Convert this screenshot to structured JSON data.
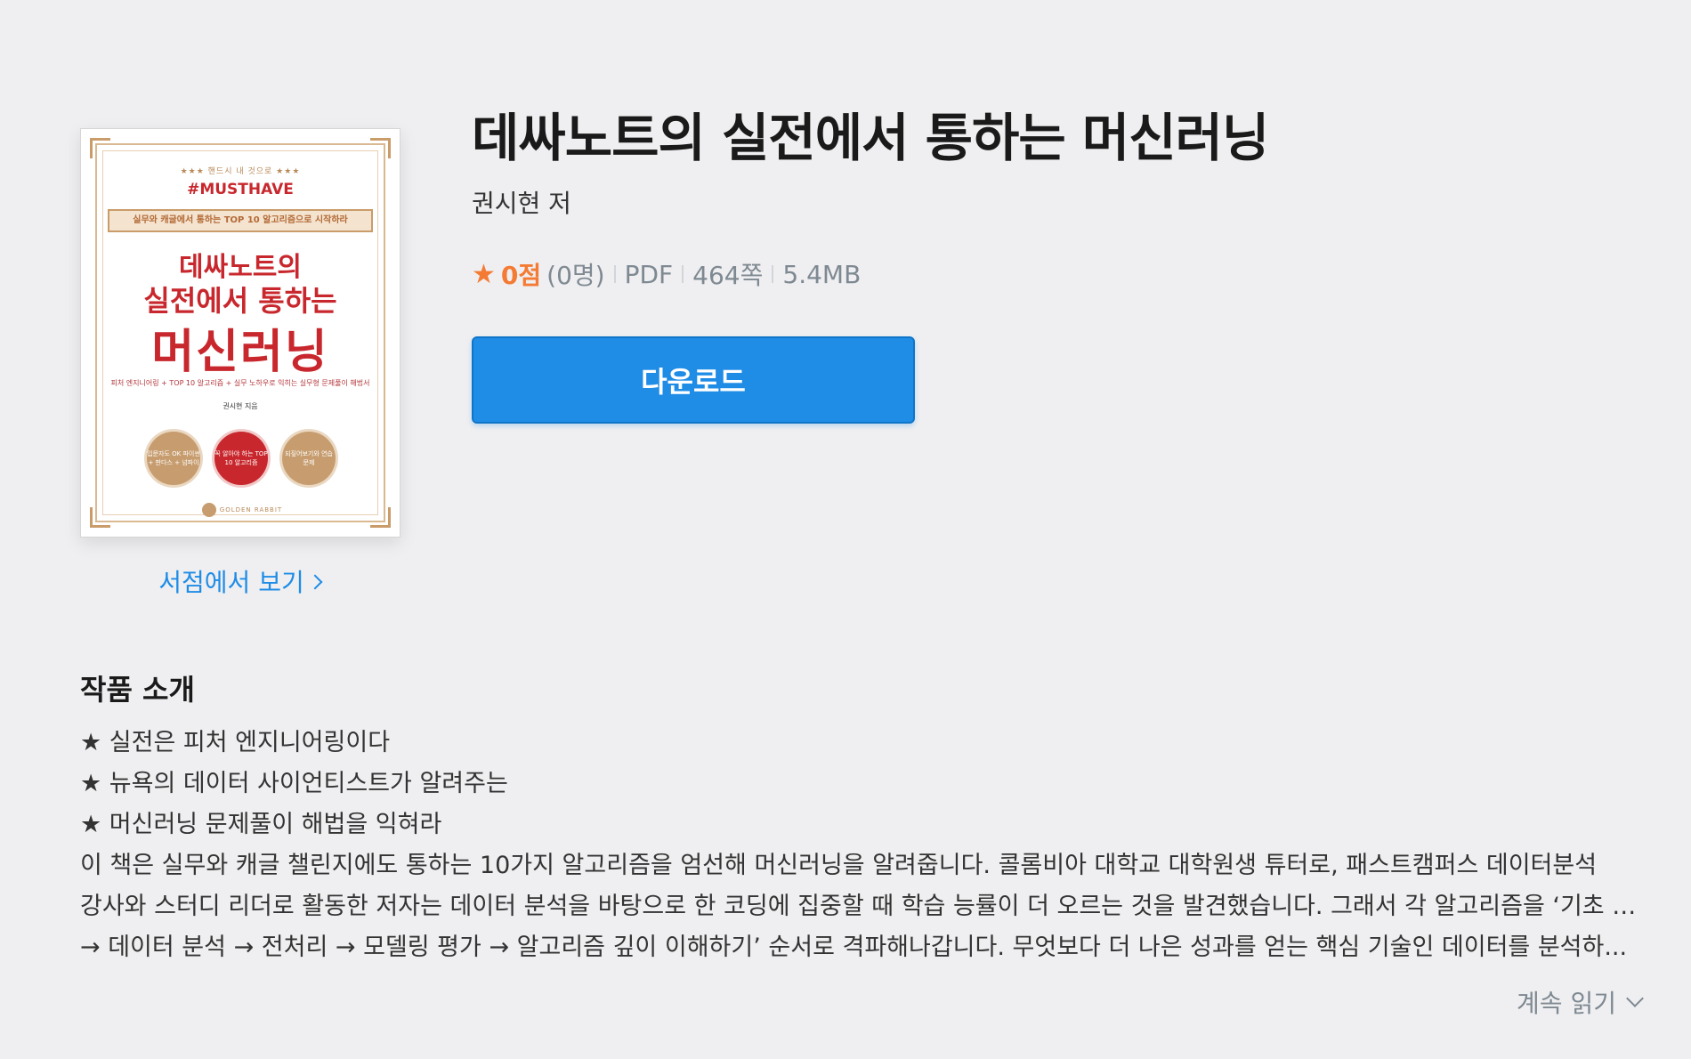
{
  "book": {
    "title": "데싸노트의 실전에서 통하는 머신러닝",
    "author": "권시현 저",
    "rating_icon": "star-icon",
    "rating": "0점",
    "rating_count": "(0명)",
    "format": "PDF",
    "pages": "464쪽",
    "file_size": "5.4MB",
    "download_label": "다운로드",
    "store_link_label": "서점에서 보기"
  },
  "cover": {
    "kicker": "★★★ 핸드시 내 것으로 ★★★",
    "tag": "#MUSTHAVE",
    "ribbon": "실무와 캐글에서 통하는 TOP 10 알고리즘으로 시작하라",
    "title_line1": "데싸노트의",
    "title_line2": "실전에서 통하는",
    "title_line3": "머신러닝",
    "subtitle": "피처 엔지니어링 + TOP 10 알고리즘 + 실무 노하우로 익히는 실무형 문제풀이 해법서",
    "author": "권시현 지음",
    "badges": [
      "입문자도 OK 파이썬 + 판다스 + 넘파이",
      "꼭 알아야 하는 TOP 10 알고리즘",
      "되짚어보기와 연습문제"
    ],
    "publisher": "GOLDEN RABBIT",
    "accent_color": "#c8282d",
    "gold_color": "#c79d6f"
  },
  "intro": {
    "heading": "작품 소개",
    "lines": [
      "★ 실전은 피처 엔지니어링이다",
      "★ 뉴욕의 데이터 사이언티스트가 알려주는",
      "★ 머신러닝 문제풀이 해법을 익혀라",
      "이 책은 실무와 캐글 챌린지에도 통하는 10가지 알고리즘을 엄선해 머신러닝을 알려줍니다. 콜롬비아 대학교 대학원생 튜터로, 패스트캠퍼스 데이터분석",
      "강사와 스터디 리더로 활동한 저자는 데이터 분석을 바탕으로 한 코딩에 집중할 때 학습 능률이 더 오르는 것을 발견했습니다. 그래서 각 알고리즘을 ‘기초 지식",
      "→ 데이터 분석 → 전처리 → 모델링 평가 → 알고리즘 깊이 이해하기’ 순서로 격파해나갑니다. 무엇보다 더 나은 성과를 얻는 핵심 기술인 데이터를 분석하..."
    ],
    "read_more_label": "계속 읽기"
  },
  "colors": {
    "background": "#efeff1",
    "primary": "#1f8ce6",
    "rating": "#f47b34",
    "muted": "#7e8992"
  }
}
